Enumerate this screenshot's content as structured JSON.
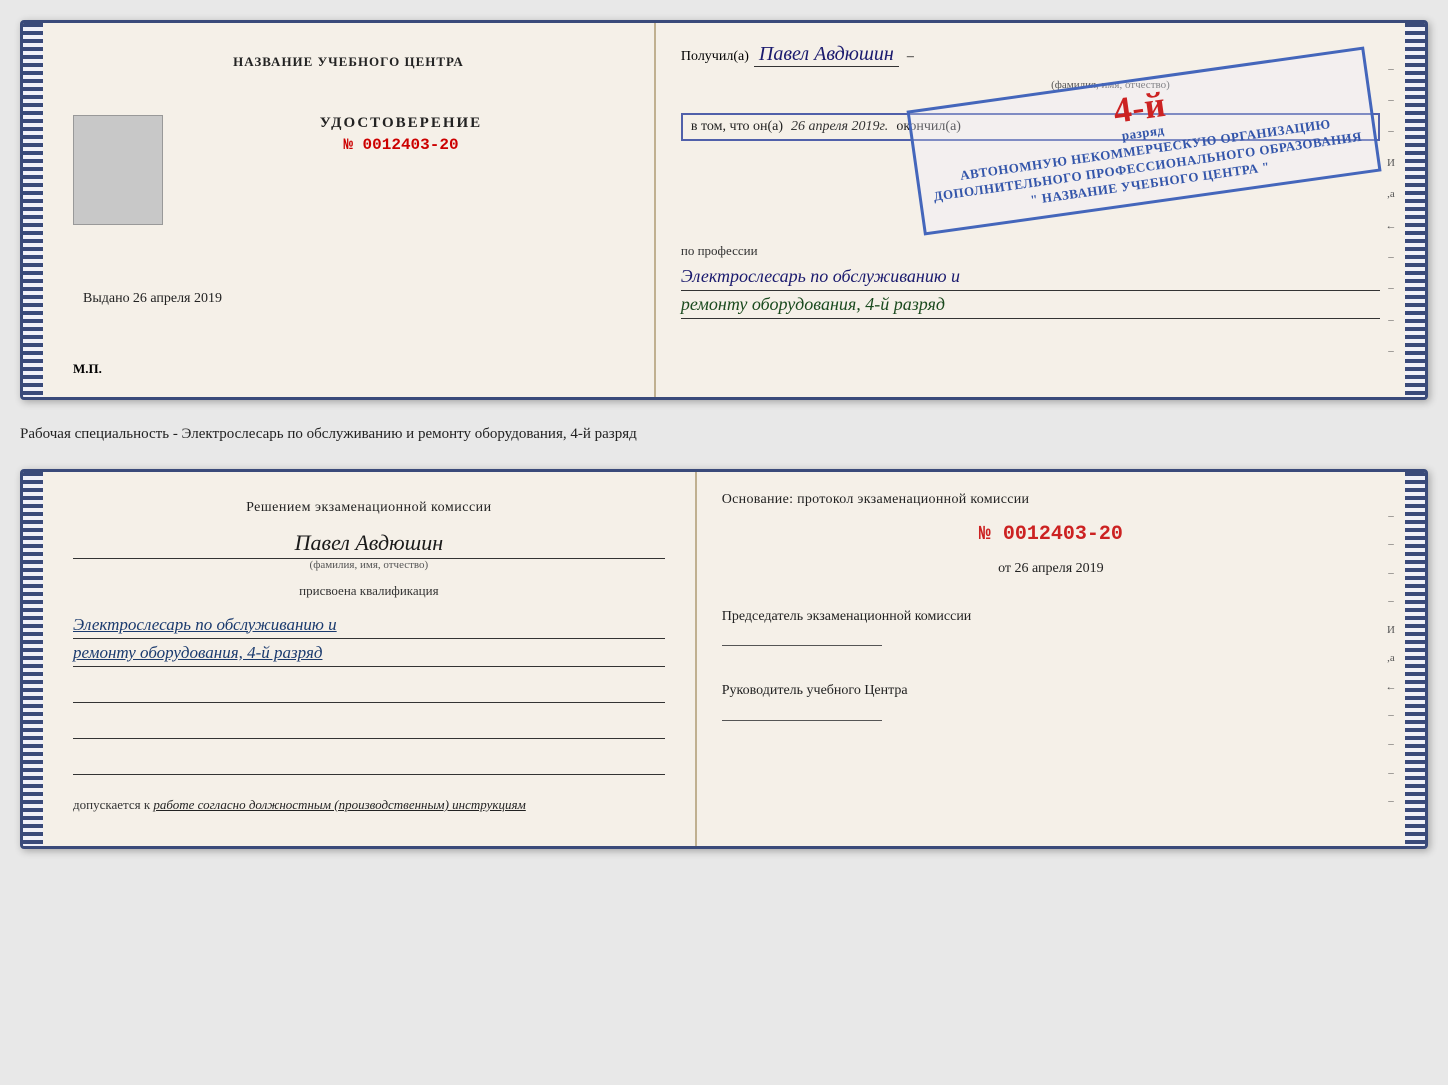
{
  "top_doc": {
    "left": {
      "title": "НАЗВАНИЕ УЧЕБНОГО ЦЕНТРА",
      "cert_label": "УДОСТОВЕРЕНИЕ",
      "cert_number": "№ 0012403-20",
      "issued_label": "Выдано",
      "issued_date": "26 апреля 2019",
      "mp_label": "М.П."
    },
    "right": {
      "received_prefix": "Получил(а)",
      "received_name": "Павел Авдюшин",
      "fio_hint": "(фамилия, имя, отчество)",
      "dash": "–",
      "vtom_prefix": "в том, что он(а)",
      "vtom_date": "26 апреля 2019г.",
      "vtom_okonchill": "окончил(а)",
      "stamp_line1": "АВТОНОМНУЮ НЕКОММЕРЧЕСКУЮ ОРГАНИЗАЦИЮ",
      "stamp_line2": "ДОПОЛНИТЕЛЬНОГО ПРОФЕССИОНАЛЬНОГО ОБРАЗОВАНИЯ",
      "stamp_line3": "\" НАЗВАНИЕ УЧЕБНОГО ЦЕНТРА \"",
      "stamp_razryad": "4-й",
      "stamp_suffix": "разряд",
      "profession_label": "по профессии",
      "profession_line1": "Электрослесарь по обслуживанию и",
      "profession_line2": "ремонту оборудования, 4-й разряд",
      "side_marks": [
        "–",
        "–",
        "–",
        "И",
        ",а",
        "←",
        "–",
        "–",
        "–",
        "–"
      ]
    }
  },
  "middle_text": "Рабочая специальность - Электрослесарь по обслуживанию и ремонту оборудования, 4-й разряд",
  "bottom_doc": {
    "left": {
      "decision_label": "Решением экзаменационной комиссии",
      "person_name": "Павел Авдюшин",
      "fio_hint": "(фамилия, имя, отчество)",
      "assigned_label": "присвоена квалификация",
      "qualification_line1": "Электрослесарь по обслуживанию и",
      "qualification_line2": "ремонту оборудования, 4-й разряд",
      "допускается_prefix": "допускается к",
      "допускается_value": "работе согласно должностным (производственным) инструкциям"
    },
    "right": {
      "osnov_label": "Основание: протокол экзаменационной комиссии",
      "protocol_number": "№ 0012403-20",
      "ot_prefix": "от",
      "ot_date": "26 апреля 2019",
      "chairman_label": "Председатель экзаменационной комиссии",
      "leader_label": "Руководитель учебного Центра",
      "side_marks": [
        "–",
        "–",
        "–",
        "–",
        "И",
        ",а",
        "←",
        "–",
        "–",
        "–",
        "–"
      ]
    }
  }
}
